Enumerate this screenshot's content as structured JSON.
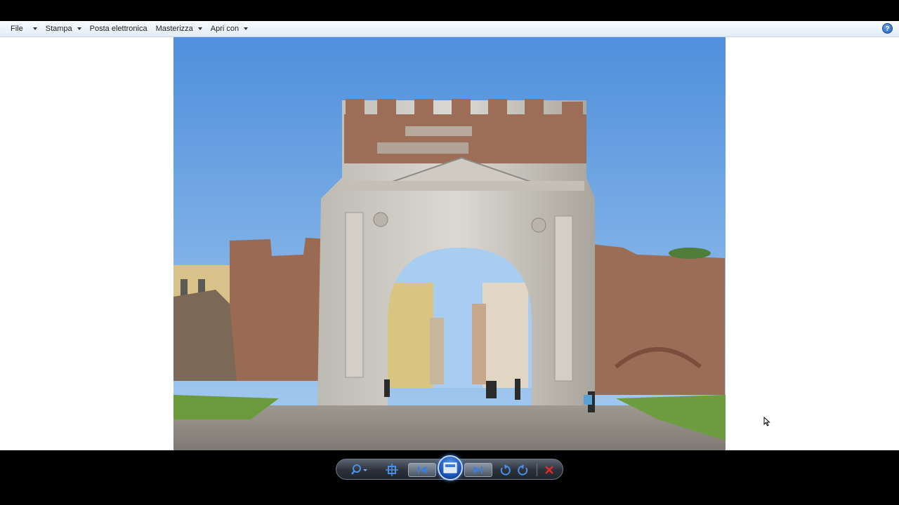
{
  "menu": {
    "file": "File",
    "print": "Stampa",
    "email": "Posta elettronica",
    "burn": "Masterizza",
    "open_with": "Apri con",
    "help": "?"
  },
  "icons": {
    "help": "help-icon",
    "zoom": "magnifier-icon",
    "actual_size": "fit-window-icon",
    "previous": "previous-icon",
    "slideshow": "slideshow-icon",
    "next": "next-icon",
    "rotate_ccw": "rotate-counterclockwise-icon",
    "rotate_cw": "rotate-clockwise-icon",
    "delete": "delete-x-icon",
    "cursor": "mouse-pointer-icon"
  },
  "colors": {
    "menubar_top": "#f7fbfe",
    "menubar_bottom": "#e3edf7",
    "control_blue": "#3b7de0",
    "delete_red": "#e02a2a",
    "sky_top": "#4f8fdc",
    "sky_bottom": "#a9cdf0"
  }
}
